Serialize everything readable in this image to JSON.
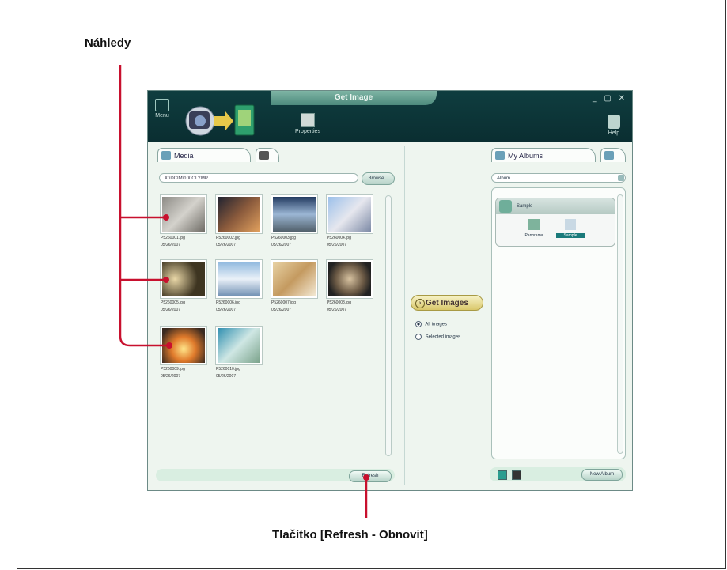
{
  "callouts": {
    "thumbnails": "Náhledy",
    "refresh_button": "Tlačítko [Refresh - Obnovit]"
  },
  "window": {
    "title": "Get Image",
    "controls": "_ ▢ ✕",
    "menu_label": "Menu",
    "properties_label": "Properties",
    "help_label": "Help"
  },
  "left_panel": {
    "tabs": [
      "Media",
      ""
    ],
    "path": "X:\\DCIM\\100OLYMP",
    "browse_label": "Browse...",
    "refresh_label": "Refresh",
    "thumbnails": [
      {
        "file": "P5260001.jpg",
        "date": "05/26/2007"
      },
      {
        "file": "P5260002.jpg",
        "date": "05/26/2007"
      },
      {
        "file": "P5260003.jpg",
        "date": "05/26/2007"
      },
      {
        "file": "P5260004.jpg",
        "date": "05/26/2007"
      },
      {
        "file": "P5260005.jpg",
        "date": "05/26/2007"
      },
      {
        "file": "P5260006.jpg",
        "date": "05/26/2007"
      },
      {
        "file": "P5260007.jpg",
        "date": "05/26/2007"
      },
      {
        "file": "P5260008.jpg",
        "date": "05/26/2007"
      },
      {
        "file": "P5260009.jpg",
        "date": "05/26/2007"
      },
      {
        "file": "P5260010.jpg",
        "date": "05/26/2007"
      }
    ]
  },
  "center": {
    "get_images_label": "Get Images",
    "options": [
      "All images",
      "Selected images"
    ],
    "selected_option": "All images"
  },
  "right_panel": {
    "tabs": [
      "My Albums",
      ""
    ],
    "album_select_value": "Album",
    "album_card_title": "Sample",
    "album_items": [
      "Panorama",
      "Sample"
    ],
    "new_album_label": "New Album"
  },
  "colors": {
    "accent_red": "#c8102e",
    "title_bar": "#0f3d3f",
    "panel_bg": "#eef5ef"
  }
}
